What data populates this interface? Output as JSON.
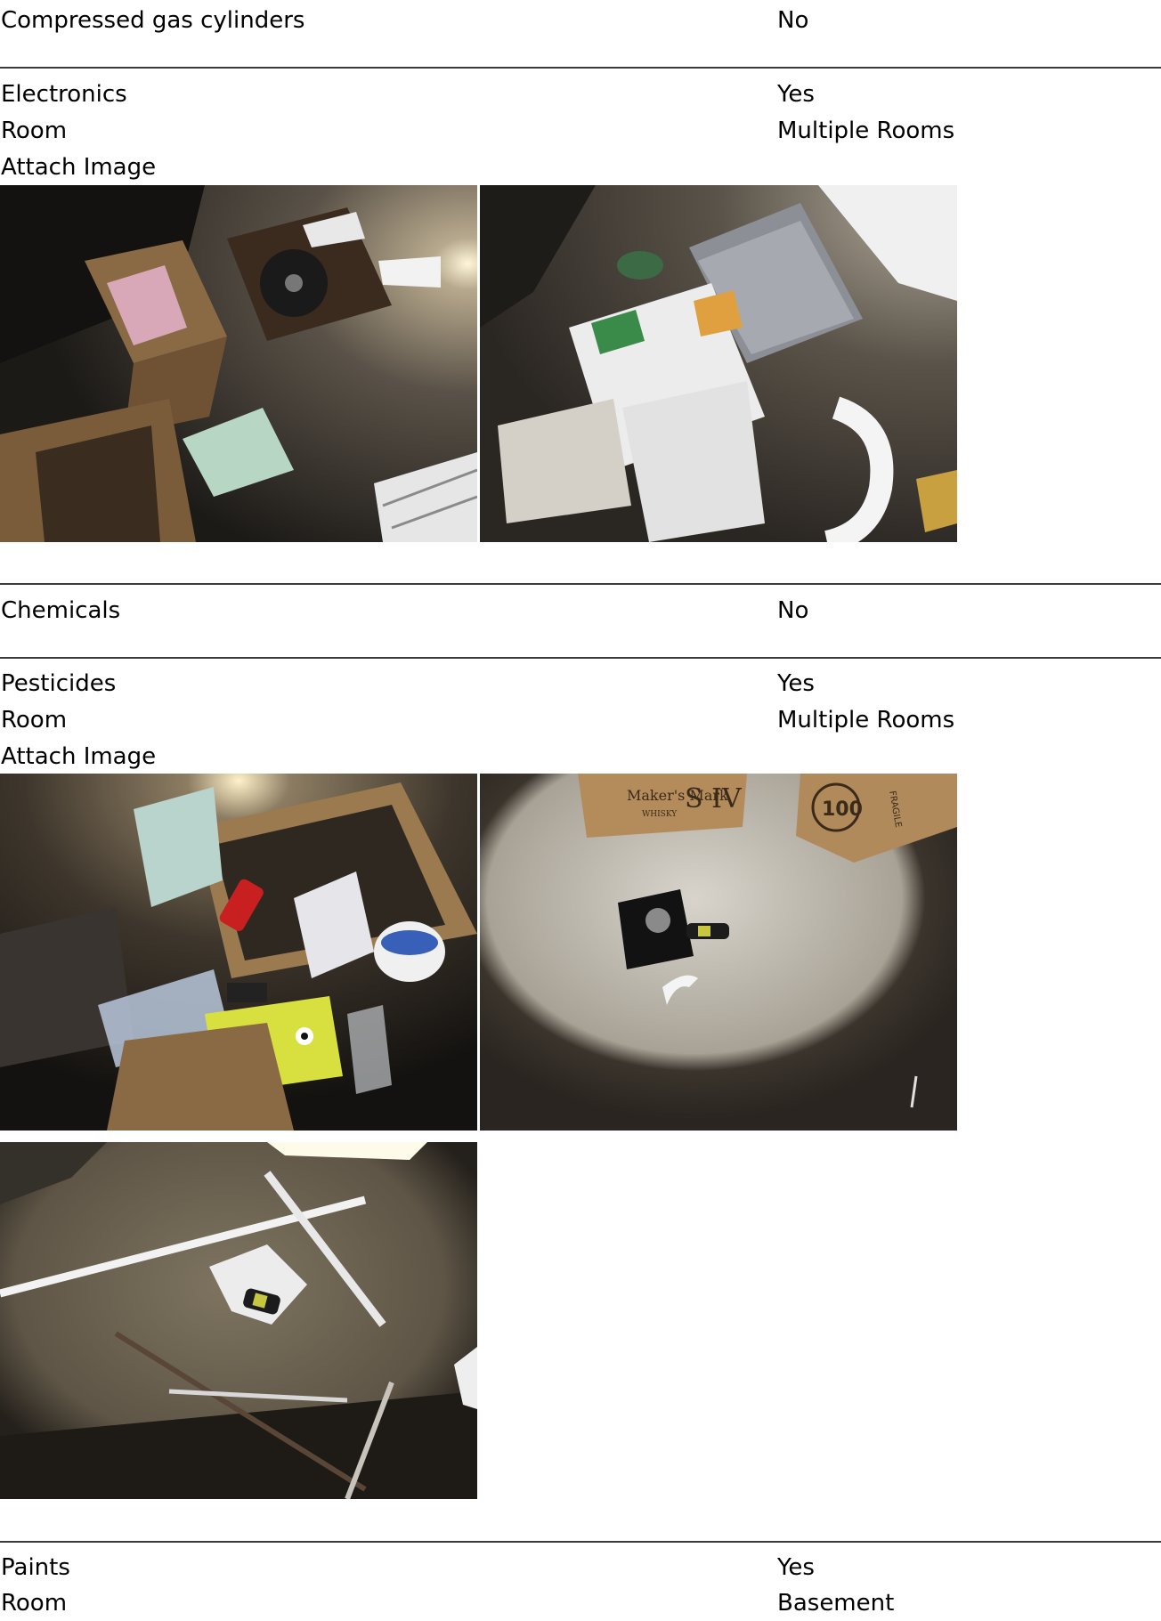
{
  "sections": [
    {
      "label": "Compressed gas cylinders",
      "value": "No"
    },
    {
      "label": "Electronics",
      "value": "Yes",
      "room_label": "Room",
      "room_value": "Multiple Rooms",
      "attach_label": "Attach Image"
    },
    {
      "label": "Chemicals",
      "value": "No"
    },
    {
      "label": "Pesticides",
      "value": "Yes",
      "room_label": "Room",
      "room_value": "Multiple Rooms",
      "attach_label": "Attach Image"
    },
    {
      "label": "Paints",
      "value": "Yes",
      "room_label": "Room",
      "room_value": "Basement"
    }
  ],
  "photo_text": {
    "box_brand": "Maker's Mark",
    "box_brand_sub": "WHISKY",
    "box_mark": "S IV",
    "box_badge": "100",
    "box_side": "FRAGILE"
  },
  "colors": {
    "divider": "#3a3a3a",
    "floor_dark": "#2b2824",
    "cardboard": "#8a6a44"
  }
}
